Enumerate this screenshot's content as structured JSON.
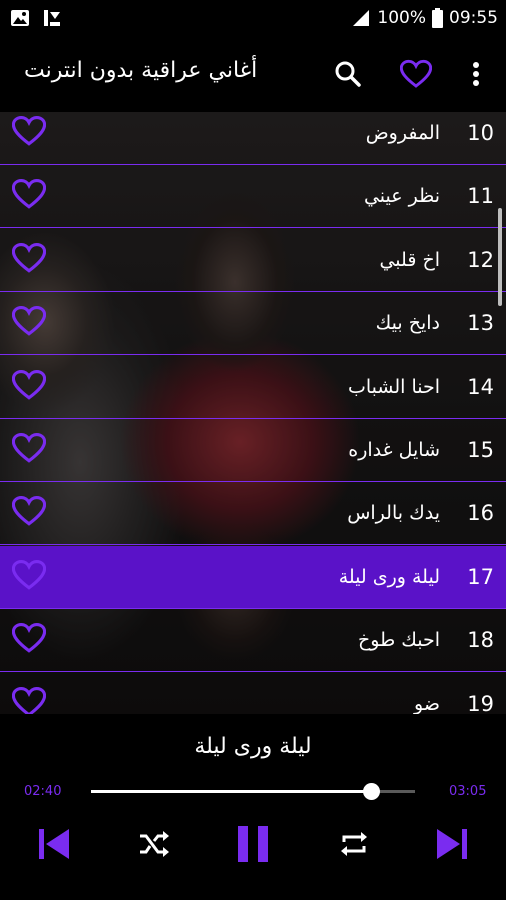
{
  "status_bar": {
    "battery": "100%",
    "time": "09:55"
  },
  "app_bar": {
    "title": "أغاني عراقية بدون انترنت",
    "icons": [
      "search-icon",
      "favorite-heart-icon",
      "more-vert-icon"
    ]
  },
  "songs": [
    {
      "number": "10",
      "title": "المفروض"
    },
    {
      "number": "11",
      "title": "نظر عيني"
    },
    {
      "number": "12",
      "title": "اخ قلبي"
    },
    {
      "number": "13",
      "title": "دايخ بيك"
    },
    {
      "number": "14",
      "title": "احنا الشباب"
    },
    {
      "number": "15",
      "title": "شايل غداره"
    },
    {
      "number": "16",
      "title": "يدك بالراس"
    },
    {
      "number": "17",
      "title": "ليلة ورى ليلة",
      "active": true
    },
    {
      "number": "18",
      "title": "احبك طوخ"
    },
    {
      "number": "19",
      "title": "ضو"
    }
  ],
  "player": {
    "now_playing": "ليلة ورى ليلة",
    "elapsed": "02:40",
    "duration": "03:05",
    "progress": 0.865,
    "controls": [
      "skip-previous-icon",
      "shuffle-icon",
      "pause-icon",
      "repeat-icon",
      "skip-next-icon"
    ]
  },
  "colors": {
    "accent": "#7a2cf0",
    "active_row": "#5a12c8",
    "background": "#000000"
  }
}
